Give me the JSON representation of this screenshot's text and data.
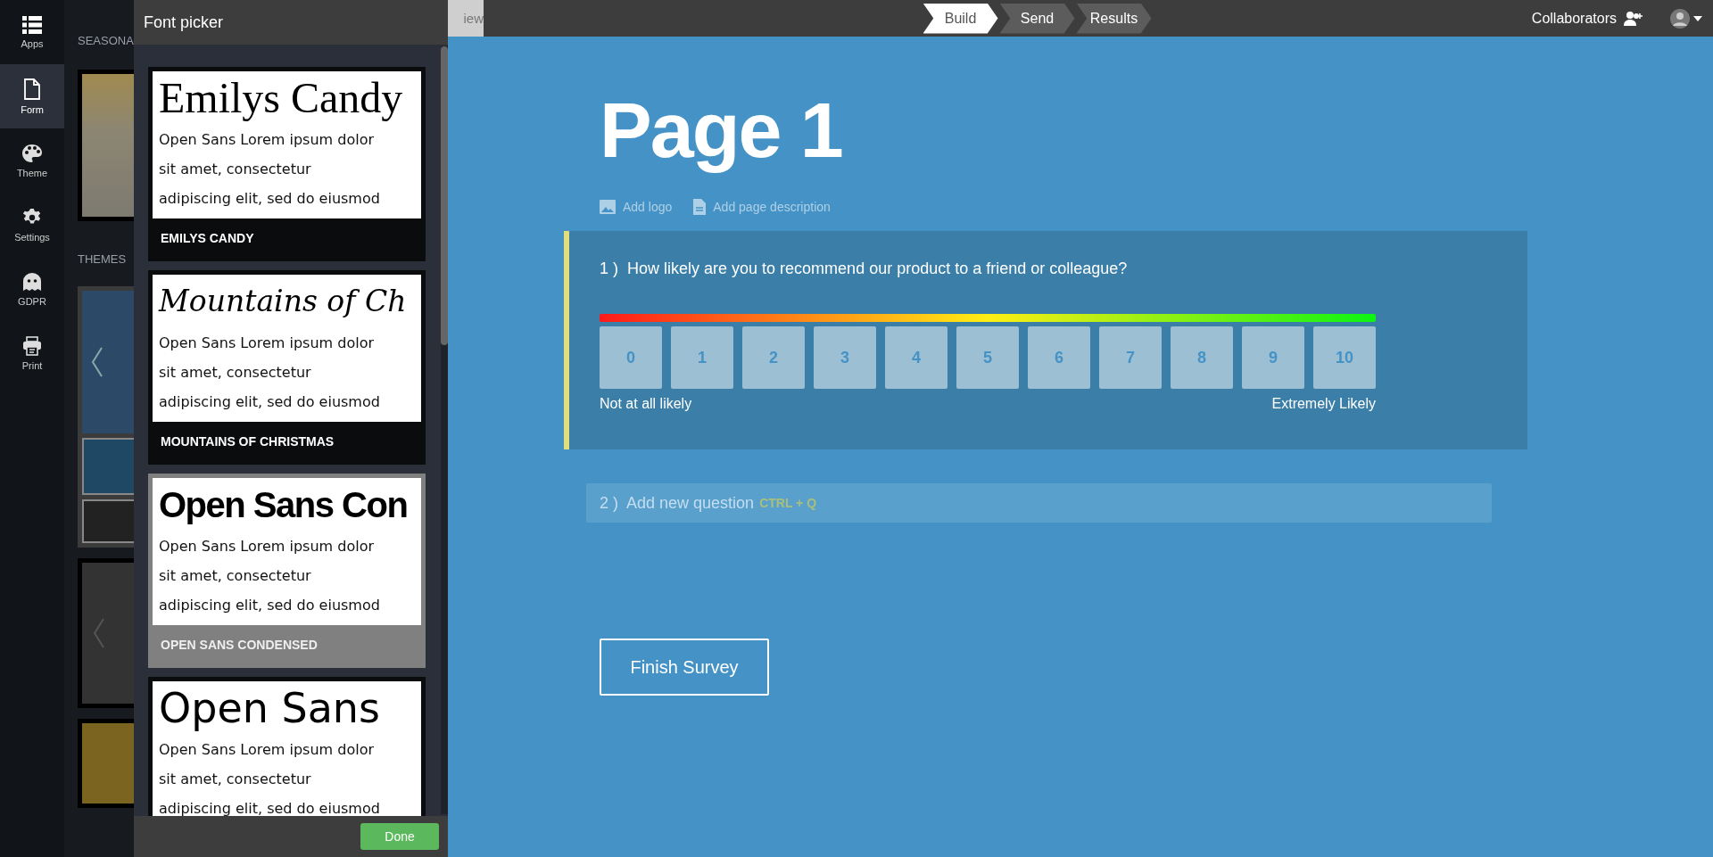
{
  "sidebar": {
    "items": [
      {
        "label": "Apps",
        "selected": false
      },
      {
        "label": "Form",
        "selected": true
      },
      {
        "label": "Theme",
        "selected": false
      },
      {
        "label": "Settings",
        "selected": false
      },
      {
        "label": "GDPR",
        "selected": false
      },
      {
        "label": "Print",
        "selected": false
      }
    ]
  },
  "theme_panel": {
    "sections": [
      "SEASONA",
      "THEMES"
    ]
  },
  "font_picker": {
    "title": "Font picker",
    "fonts": [
      {
        "sample": "Emilys Candy",
        "body_lines": [
          "Open Sans Lorem ipsum dolor",
          "sit amet, consectetur",
          "adipiscing elit, sed do eiusmod"
        ],
        "label": "EMILYS CANDY",
        "selected": false
      },
      {
        "sample": "Mountains of Ch",
        "body_lines": [
          "Open Sans Lorem ipsum dolor",
          "sit amet, consectetur",
          "adipiscing elit, sed do eiusmod"
        ],
        "label": "MOUNTAINS OF CHRISTMAS",
        "selected": false
      },
      {
        "sample": "Open Sans Con",
        "body_lines": [
          "Open Sans Lorem ipsum dolor",
          "sit amet, consectetur",
          "adipiscing elit, sed do eiusmod"
        ],
        "label": "OPEN SANS CONDENSED",
        "selected": true
      },
      {
        "sample": "Open Sans",
        "body_lines": [
          "Open Sans Lorem ipsum dolor",
          "sit amet, consectetur",
          "adipiscing elit, sed do eiusmod"
        ],
        "selected": false
      }
    ],
    "done": "Done"
  },
  "top_bar": {
    "view_tab": "iew",
    "steps": [
      {
        "label": "Build",
        "selected": true
      },
      {
        "label": "Send",
        "selected": false
      },
      {
        "label": "Results",
        "selected": false
      }
    ],
    "collaborators": "Collaborators"
  },
  "page": {
    "title": "Page 1",
    "actions": [
      "Add logo",
      "Add page description"
    ],
    "questions": [
      {
        "number": "1 )",
        "text": "How likely are you to recommend our product to a friend or colleague?",
        "scale": [
          "0",
          "1",
          "2",
          "3",
          "4",
          "5",
          "6",
          "7",
          "8",
          "9",
          "10"
        ],
        "low_label": "Not at all likely",
        "high_label": "Extremely Likely"
      }
    ],
    "new_question": {
      "number": "2 )",
      "placeholder": "Add new question",
      "shortcut": "CTRL + Q"
    },
    "finish_button": "Finish Survey"
  }
}
